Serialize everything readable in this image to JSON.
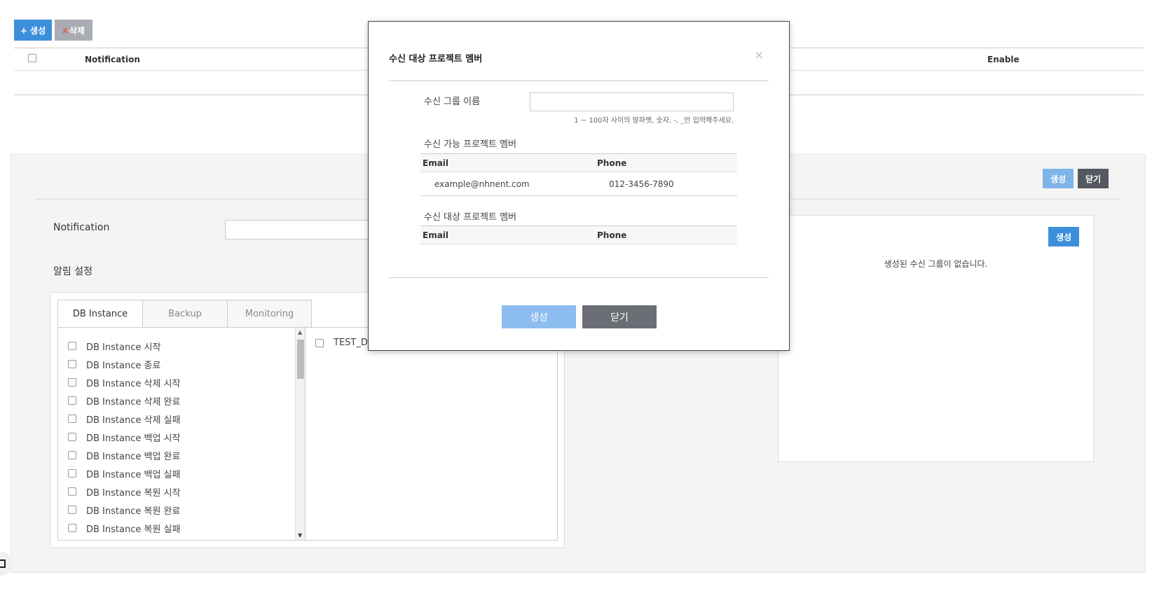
{
  "toolbar": {
    "create_label": "+ 생성",
    "delete_x": "x",
    "delete_label": "삭제"
  },
  "list": {
    "columns": {
      "notification": "Notification",
      "enable": "Enable"
    }
  },
  "panel": {
    "create_label": "생성",
    "close_label": "닫기",
    "notification_label": "Notification",
    "notification_value": "",
    "alert_label": "알림 설정",
    "tabs": [
      "DB Instance",
      "Backup",
      "Monitoring"
    ],
    "events": [
      "DB Instance 시작",
      "DB Instance 종료",
      "DB Instance 삭제 시작",
      "DB Instance 삭제 완료",
      "DB Instance 삭제 실패",
      "DB Instance 백업 시작",
      "DB Instance 백업 완료",
      "DB Instance 백업 실패",
      "DB Instance 복원 시작",
      "DB Instance 복원 완료",
      "DB Instance 복원 실패"
    ],
    "target_item": "TEST_D_",
    "groups_create_label": "생성",
    "groups_empty": "생성된 수신 그룹이 없습니다."
  },
  "modal": {
    "title": "수신 대상 프로젝트 멤버",
    "close_symbol": "×",
    "group_name_label": "수신 그룹 이름",
    "group_name_value": "",
    "hint": "1 ~ 100자 사이의 알파벳, 숫자, -, _만 입력해주세요.",
    "available_label": "수신 가능 프로젝트 멤버",
    "target_label": "수신 대상 프로젝트 멤버",
    "col_email": "Email",
    "col_phone": "Phone",
    "available_members": [
      {
        "email": "example@nhnent.com",
        "phone": "012-3456-7890"
      }
    ],
    "create_label": "생성",
    "close_label": "닫기"
  },
  "icons": {
    "side": "chevron-right-icon",
    "scroll_up": "arrow-up-icon",
    "scroll_down": "arrow-down-icon",
    "close": "close-icon"
  },
  "colors": {
    "primary": "#3d8fdc",
    "primary_light": "#8dbdee",
    "dark": "#6b6e74"
  }
}
